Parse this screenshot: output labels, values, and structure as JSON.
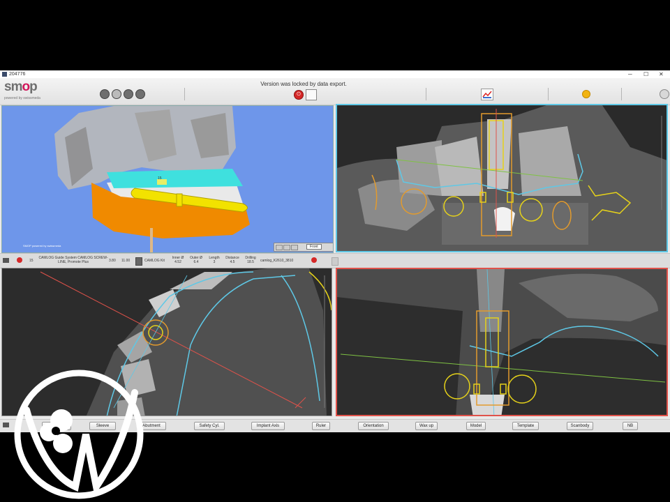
{
  "window": {
    "title": "204776"
  },
  "header": {
    "logo_text_prefix": "sm",
    "logo_text_o": "o",
    "logo_text_suffix": "p",
    "logo_sub": "powered by swissmeda",
    "lock_message": "Version was locked by data export.",
    "window_controls": [
      "─",
      "☐",
      "✕"
    ]
  },
  "viewport_3d": {
    "caption": "SMOP powered by swissmeda",
    "view_select": "Front",
    "tooth_label": "15"
  },
  "implant_info": {
    "tooth": "15",
    "system": "CAMLOG Guide System CAMLOG SCREW-LINE, Promote Plus",
    "diameter": "3.80",
    "length": "11.00",
    "kit": "CAMLOG Kit",
    "inner_label": "Inner Ø",
    "inner_value": "4.52",
    "outer_label": "Outer Ø",
    "outer_value": "6.4",
    "length_label": "Length",
    "length_value": "3",
    "distance_label": "Distance",
    "distance_value": "4.5",
    "drilling_label": "Drilling",
    "drilling_value": "18.5",
    "sleeve_code": "camlog_K2610_3810"
  },
  "bottom_toolbar": {
    "buttons": [
      "Abutment",
      "Safety Cyl.",
      "Implant Axis",
      "Ruler",
      "Orientation",
      "Wax up",
      "Model",
      "Template",
      "Scanbody",
      "NB"
    ],
    "partial_left_1": "Implant",
    "partial_left_2": "Sleeve"
  },
  "colors": {
    "accent": "#d2175b",
    "viewport_bg": "#6e96ea",
    "guide_cyan": "#5ec8e6",
    "implant_orange": "#e39b2d",
    "implant_yellow": "#e6d21a",
    "axis_red": "#e0524a",
    "plane_green": "#7fc243",
    "status_dot": "#f2b411"
  },
  "icons": [
    "camera-icon",
    "lock-icon",
    "export-icon",
    "chart-icon",
    "status-dot-icon",
    "fullscreen-icon",
    "implant-kit-icon"
  ]
}
